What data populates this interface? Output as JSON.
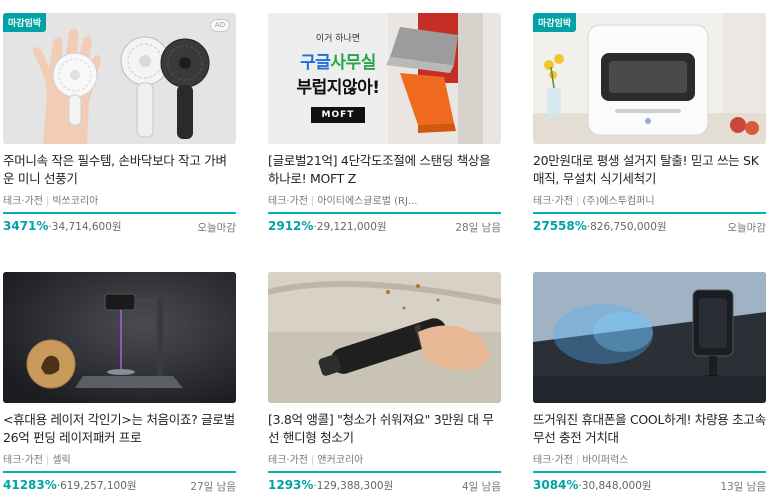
{
  "cards": [
    {
      "badge": "마감임박",
      "ad": "AD",
      "title": "주머니속 작은 필수템, 손바닥보다 작고 가벼운 미니 선풍기",
      "category": "테크·가전",
      "maker": "빅쏘코리아",
      "percent": "3471%",
      "amount": "·34,714,600원",
      "remaining": "오늘마감"
    },
    {
      "banner_line1": "이거 하나면",
      "banner_line2_a": "구글",
      "banner_line2_b": "사무실",
      "banner_line3": "부럽지않아!",
      "banner_logo": "MOFT",
      "title": "[글로벌21억] 4단각도조절에 스탠딩 책상을 하나로! MOFT Z",
      "category": "테크·가전",
      "maker": "아이티에스글로벌 (RJ...",
      "percent": "2912%",
      "amount": "·29,121,000원",
      "remaining": "28일 남음"
    },
    {
      "badge": "마감임박",
      "title": "20만원대로 평생 설거지 탈출! 믿고 쓰는 SK매직, 무설치 식기세척기",
      "category": "테크·가전",
      "maker": "(주)에스투컴퍼니",
      "percent": "27558%",
      "amount": "·826,750,000원",
      "remaining": "오늘마감"
    },
    {
      "title": "<휴대용 레이저 각인기>는 처음이죠? 글로벌 26억 펀딩 레이저패커 프로",
      "category": "테크·가전",
      "maker": "셀릭",
      "percent": "41283%",
      "amount": "·619,257,100원",
      "remaining": "27일 남음"
    },
    {
      "title": "[3.8억 앵콜] \"청소가 쉬워져요\" 3만원 대 무선 핸디형 청소기",
      "category": "테크·가전",
      "maker": "앤커코리아",
      "percent": "1293%",
      "amount": "·129,388,300원",
      "remaining": "4일 남음"
    },
    {
      "title": "뜨거워진 휴대폰을 COOL하게! 차량용 초고속 무선 충전 거치대",
      "category": "테크·가전",
      "maker": "바이퍼럭스",
      "percent": "3084%",
      "amount": "·30,848,000원",
      "remaining": "13일 남음"
    }
  ],
  "colors": {
    "accent": "#00a2a6",
    "bar": "#00b2b2"
  }
}
